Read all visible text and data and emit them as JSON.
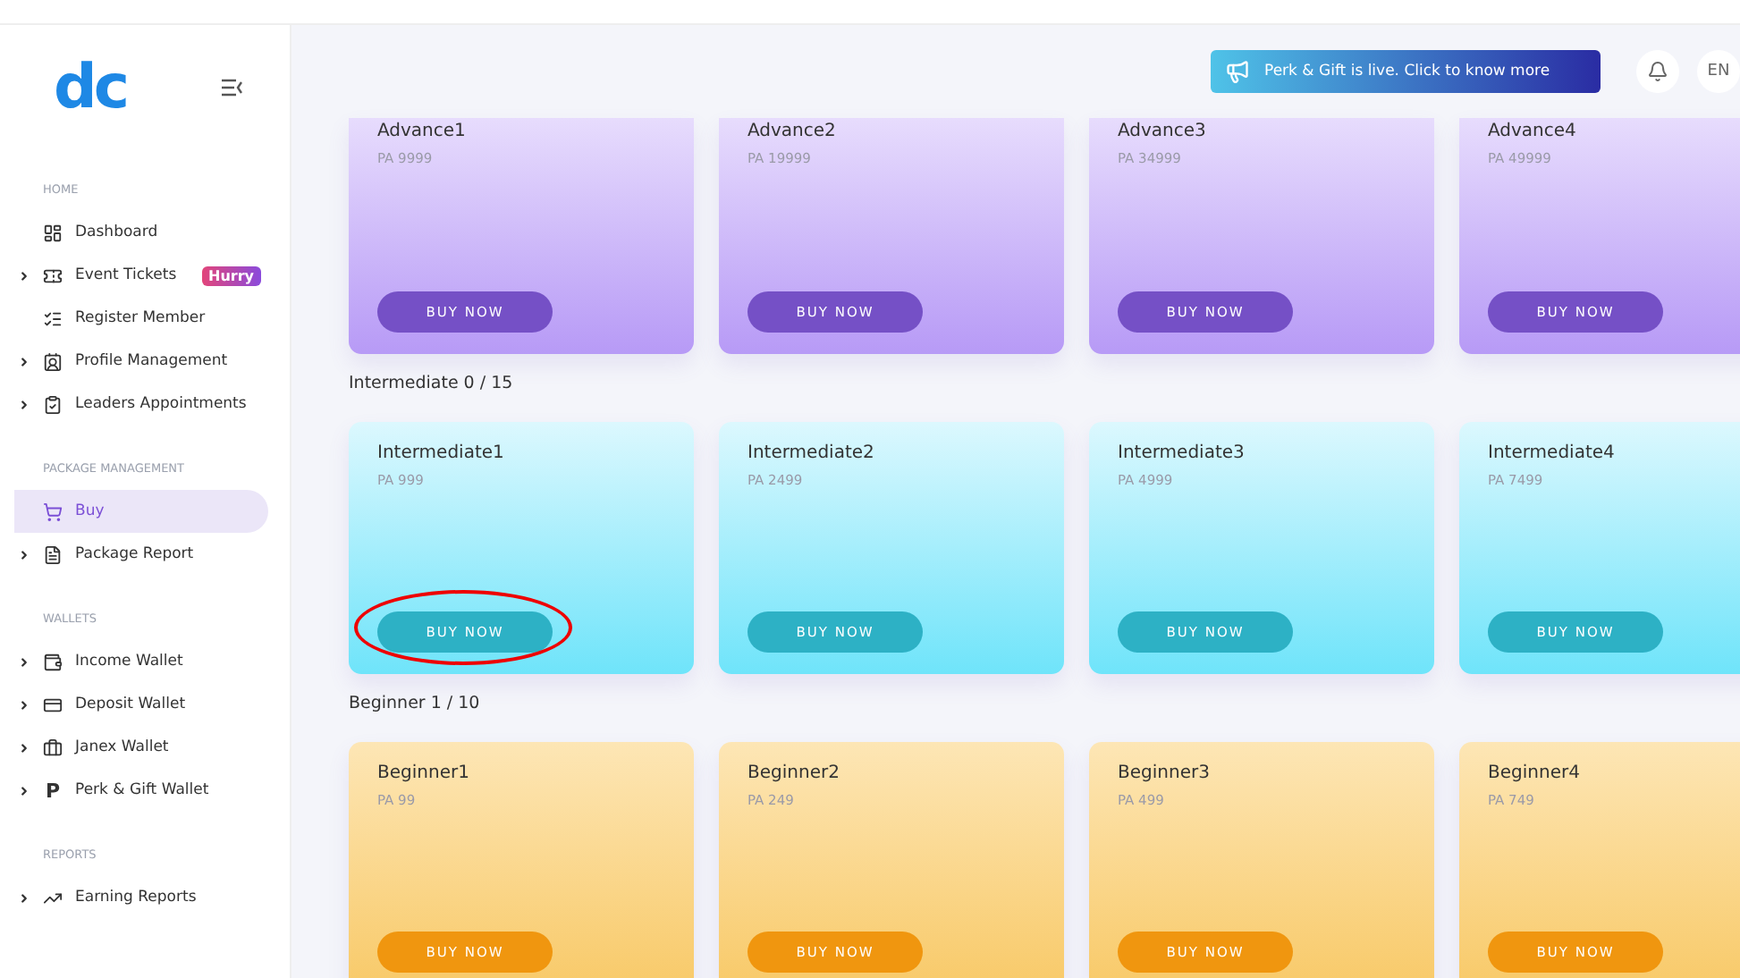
{
  "sidebar": {
    "logo": "dc",
    "sections": [
      {
        "title": "HOME",
        "items": [
          {
            "label": "Dashboard",
            "expandable": false,
            "selected": false
          },
          {
            "label": "Event Tickets",
            "expandable": true,
            "selected": false,
            "badge": "Hurry"
          },
          {
            "label": "Register Member",
            "expandable": false,
            "selected": false
          },
          {
            "label": "Profile Management",
            "expandable": true,
            "selected": false
          },
          {
            "label": "Leaders Appointments",
            "expandable": true,
            "selected": false
          }
        ]
      },
      {
        "title": "PACKAGE MANAGEMENT",
        "items": [
          {
            "label": "Buy",
            "expandable": false,
            "selected": true
          },
          {
            "label": "Package Report",
            "expandable": true,
            "selected": false
          }
        ]
      },
      {
        "title": "WALLETS",
        "items": [
          {
            "label": "Income Wallet",
            "expandable": true,
            "selected": false
          },
          {
            "label": "Deposit Wallet",
            "expandable": true,
            "selected": false
          },
          {
            "label": "Janex Wallet",
            "expandable": true,
            "selected": false
          },
          {
            "label": "Perk & Gift Wallet",
            "glyph": "P",
            "expandable": true,
            "selected": false
          }
        ]
      },
      {
        "title": "REPORTS",
        "items": [
          {
            "label": "Earning Reports",
            "expandable": true,
            "selected": false
          }
        ]
      }
    ]
  },
  "header": {
    "announcement": "Perk & Gift is live. Click to know more",
    "language": "EN"
  },
  "groups": [
    {
      "cards": [
        {
          "name": "Advance1",
          "price": "PA 9999",
          "button": "BUY NOW",
          "circled": false
        },
        {
          "name": "Advance2",
          "price": "PA 19999",
          "button": "BUY NOW",
          "circled": false
        },
        {
          "name": "Advance3",
          "price": "PA 34999",
          "button": "BUY NOW",
          "circled": false
        },
        {
          "name": "Advance4",
          "price": "PA 49999",
          "button": "BUY NOW",
          "circled": false
        }
      ]
    },
    {
      "title": "Intermediate 0 / 15",
      "cards": [
        {
          "name": "Intermediate1",
          "price": "PA 999",
          "button": "BUY NOW",
          "circled": true
        },
        {
          "name": "Intermediate2",
          "price": "PA 2499",
          "button": "BUY NOW",
          "circled": false
        },
        {
          "name": "Intermediate3",
          "price": "PA 4999",
          "button": "BUY NOW",
          "circled": false
        },
        {
          "name": "Intermediate4",
          "price": "PA 7499",
          "button": "BUY NOW",
          "circled": false
        }
      ]
    },
    {
      "title": "Beginner 1 / 10",
      "cards": [
        {
          "name": "Beginner1",
          "price": "PA 99",
          "button": "BUY NOW",
          "circled": false
        },
        {
          "name": "Beginner2",
          "price": "PA 249",
          "button": "BUY NOW",
          "circled": false
        },
        {
          "name": "Beginner3",
          "price": "PA 499",
          "button": "BUY NOW",
          "circled": false
        },
        {
          "name": "Beginner4",
          "price": "PA 749",
          "button": "BUY NOW",
          "circled": false
        }
      ]
    }
  ]
}
